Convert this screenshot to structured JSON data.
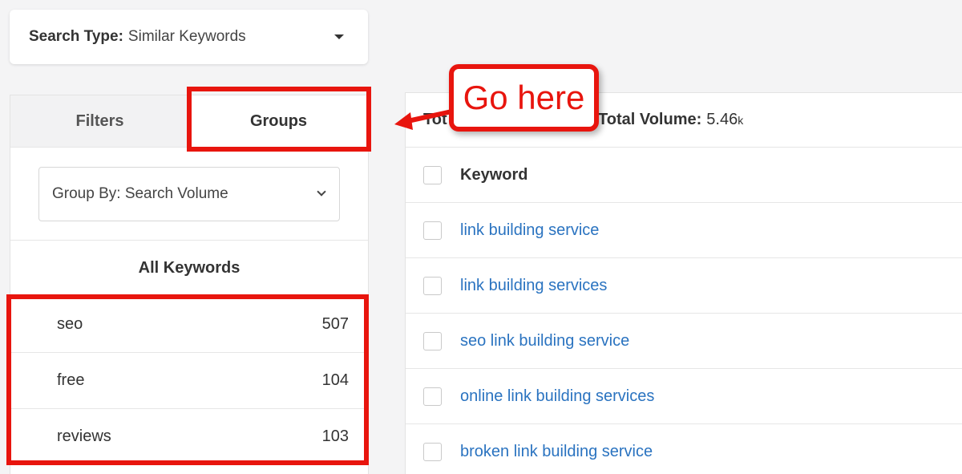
{
  "search_type": {
    "label": "Search Type:",
    "value": "Similar Keywords"
  },
  "tabs": [
    {
      "label": "Filters"
    },
    {
      "label": "Groups"
    }
  ],
  "group_by": {
    "value": "Group By: Search Volume"
  },
  "all_keywords_label": "All Keywords",
  "groups": [
    {
      "name": "seo",
      "count": "507"
    },
    {
      "name": "free",
      "count": "104"
    },
    {
      "name": "reviews",
      "count": "103"
    }
  ],
  "summary": {
    "total_prefix": "Tot",
    "total_volume_label": "Total Volume:",
    "total_volume_value": "5.46",
    "total_volume_suffix": "k"
  },
  "table": {
    "header": "Keyword",
    "rows": [
      "link building service",
      "link building services",
      "seo link building service",
      "online link building services",
      "broken link building service"
    ]
  },
  "annotation": {
    "callout_text": "Go here"
  },
  "colors": {
    "annotation_red": "#e8150e",
    "link_blue": "#2a73c0"
  }
}
